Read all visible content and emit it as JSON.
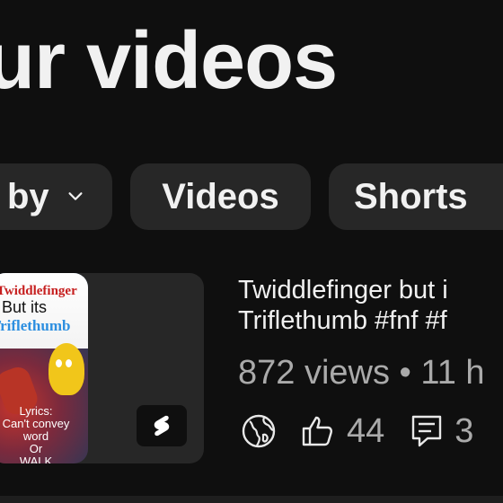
{
  "header": {
    "title": "ur videos"
  },
  "filters": {
    "sort_label": "by",
    "videos_label": "Videos",
    "shorts_label": "Shorts"
  },
  "video": {
    "thumbnail": {
      "line1": "Twiddlefinger",
      "line2": "But its",
      "line3": "Triflethumb",
      "lyrics_1": "Lyrics:",
      "lyrics_2": "Can't convey word",
      "lyrics_3": "Or",
      "lyrics_4": "WALK"
    },
    "title_line1": "Twiddlefinger but i",
    "title_line2": "Triflethumb #fnf #f",
    "meta": "872 views • 11 h",
    "visibility_icon": "globe-icon",
    "likes": "44",
    "comments": "3"
  },
  "colors": {
    "background": "#0f0f0f",
    "chip": "#272727",
    "text": "#f1f1f1",
    "secondary": "#aaaaaa"
  }
}
